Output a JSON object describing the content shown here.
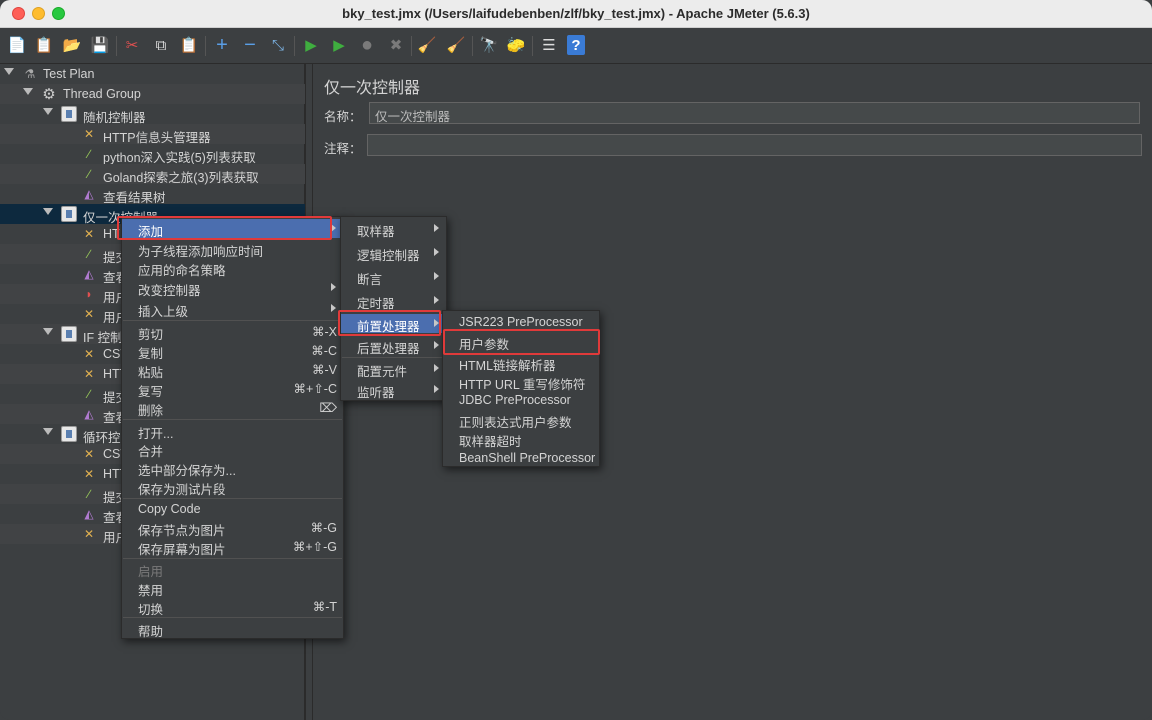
{
  "window": {
    "title": "bky_test.jmx (/Users/laifudebenben/zlf/bky_test.jmx) - Apache JMeter (5.6.3)"
  },
  "toolbar": {
    "buttons": [
      {
        "name": "new",
        "glyph": "📄"
      },
      {
        "name": "templates",
        "glyph": "📋"
      },
      {
        "name": "open",
        "glyph": "📂"
      },
      {
        "name": "save",
        "glyph": "💾"
      },
      {
        "name": "cut",
        "glyph": "✂"
      },
      {
        "name": "copy",
        "glyph": "⧉"
      },
      {
        "name": "paste",
        "glyph": "📋"
      },
      {
        "name": "expand",
        "glyph": "+"
      },
      {
        "name": "collapse",
        "glyph": "−"
      },
      {
        "name": "toggle",
        "glyph": "⤡"
      },
      {
        "name": "start",
        "glyph": "▶"
      },
      {
        "name": "start-no-pause",
        "glyph": "▶"
      },
      {
        "name": "stop",
        "glyph": "●"
      },
      {
        "name": "shutdown",
        "glyph": "✖"
      },
      {
        "name": "clear",
        "glyph": "🧹"
      },
      {
        "name": "clear-all",
        "glyph": "🧹"
      },
      {
        "name": "search",
        "glyph": "🔭"
      },
      {
        "name": "reset-search",
        "glyph": "🧽"
      },
      {
        "name": "function-helper",
        "glyph": "☰"
      },
      {
        "name": "help",
        "glyph": "?"
      }
    ]
  },
  "tree": {
    "items": [
      {
        "label": "Test Plan"
      },
      {
        "label": "Thread Group"
      },
      {
        "label": "随机控制器"
      },
      {
        "label": "HTTP信息头管理器"
      },
      {
        "label": "python深入实践(5)列表获取"
      },
      {
        "label": "Goland探索之旅(3)列表获取"
      },
      {
        "label": "查看结果树"
      },
      {
        "label": "仅一次控制器"
      },
      {
        "label": "HT"
      },
      {
        "label": "提交"
      },
      {
        "label": "查看"
      },
      {
        "label": "用户"
      },
      {
        "label": "用户"
      },
      {
        "label": "IF 控制"
      },
      {
        "label": "CSV"
      },
      {
        "label": "HTT"
      },
      {
        "label": "提交"
      },
      {
        "label": "查看"
      },
      {
        "label": "循环控制"
      },
      {
        "label": "CSV"
      },
      {
        "label": "HTT"
      },
      {
        "label": "提交"
      },
      {
        "label": "查看"
      },
      {
        "label": "用户"
      }
    ]
  },
  "panel": {
    "title": "仅一次控制器",
    "name_label": "名称：",
    "name_value": "仅一次控制器",
    "comment_label": "注释：",
    "comment_value": ""
  },
  "context_menu": {
    "items": [
      {
        "label": "添加",
        "shortcut": ""
      },
      {
        "label": "为子线程添加响应时间",
        "shortcut": ""
      },
      {
        "label": "应用的命名策略",
        "shortcut": ""
      },
      {
        "label": "改变控制器",
        "shortcut": ""
      },
      {
        "label": "插入上级",
        "shortcut": ""
      },
      {
        "label": "剪切",
        "shortcut": "⌘-X"
      },
      {
        "label": "复制",
        "shortcut": "⌘-C"
      },
      {
        "label": "粘贴",
        "shortcut": "⌘-V"
      },
      {
        "label": "复写",
        "shortcut": "⌘+⇧-C"
      },
      {
        "label": "删除",
        "shortcut": "⌦"
      },
      {
        "label": "打开...",
        "shortcut": ""
      },
      {
        "label": "合并",
        "shortcut": ""
      },
      {
        "label": "选中部分保存为...",
        "shortcut": ""
      },
      {
        "label": "保存为测试片段",
        "shortcut": ""
      },
      {
        "label": "Copy Code",
        "shortcut": ""
      },
      {
        "label": "保存节点为图片",
        "shortcut": "⌘-G"
      },
      {
        "label": "保存屏幕为图片",
        "shortcut": "⌘+⇧-G"
      },
      {
        "label": "启用",
        "shortcut": ""
      },
      {
        "label": "禁用",
        "shortcut": ""
      },
      {
        "label": "切换",
        "shortcut": "⌘-T"
      },
      {
        "label": "帮助",
        "shortcut": ""
      }
    ]
  },
  "add_submenu": {
    "items": [
      {
        "label": "取样器"
      },
      {
        "label": "逻辑控制器"
      },
      {
        "label": "断言"
      },
      {
        "label": "定时器"
      },
      {
        "label": "前置处理器"
      },
      {
        "label": "后置处理器"
      },
      {
        "label": "配置元件"
      },
      {
        "label": "监听器"
      }
    ]
  },
  "preprocessor_submenu": {
    "items": [
      {
        "label": "JSR223 PreProcessor"
      },
      {
        "label": "用户参数"
      },
      {
        "label": "HTML链接解析器"
      },
      {
        "label": "HTTP URL 重写修饰符"
      },
      {
        "label": "JDBC PreProcessor"
      },
      {
        "label": "正则表达式用户参数"
      },
      {
        "label": "取样器超时"
      },
      {
        "label": "BeanShell PreProcessor"
      }
    ]
  },
  "colors": {
    "background": "#3c3f41",
    "menu_highlight": "#4b6eaf",
    "tree_selection": "#0d293e",
    "annotation_red": "#e03a3a"
  }
}
